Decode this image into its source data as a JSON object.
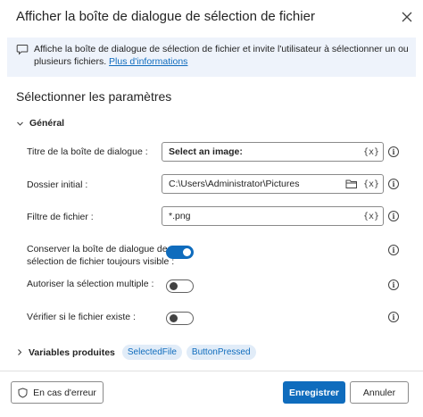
{
  "dialog": {
    "title": "Afficher la boîte de dialogue de sélection de fichier"
  },
  "info": {
    "text": "Affiche la boîte de dialogue de sélection de fichier et invite l'utilisateur à sélectionner un ou plusieurs fichiers.",
    "link": "Plus d'informations"
  },
  "section": {
    "title": "Sélectionner les paramètres",
    "group": "Général"
  },
  "fields": {
    "dialog_title": {
      "label": "Titre de la boîte de dialogue :",
      "value": "Select an image:",
      "var": "{x}"
    },
    "initial_folder": {
      "label": "Dossier initial :",
      "value": "C:\\Users\\Administrator\\Pictures",
      "var": "{x}"
    },
    "file_filter": {
      "label": "Filtre de fichier :",
      "value": "*.png",
      "var": "{x}"
    }
  },
  "toggles": {
    "keep_visible": {
      "label_line1": "Conserver la boîte de dialogue de",
      "label_line2": "sélection de fichier toujours visible :",
      "on": true
    },
    "multi_select": {
      "label": "Autoriser la sélection multiple :",
      "on": false
    },
    "check_exists": {
      "label": "Vérifier si le fichier existe :",
      "on": false
    }
  },
  "variables": {
    "label": "Variables produites",
    "items": [
      "SelectedFile",
      "ButtonPressed"
    ]
  },
  "footer": {
    "error_label": "En cas d'erreur",
    "save_label": "Enregistrer",
    "cancel_label": "Annuler"
  },
  "colors": {
    "accent": "#0f6cbd",
    "banner_bg": "#eef3fb",
    "chip_bg": "#e1ecf8"
  },
  "icons": {
    "close": "close-icon",
    "message": "message-icon",
    "chevron_down": "chevron-down-icon",
    "chevron_right": "chevron-right-icon",
    "folder": "folder-icon",
    "info": "info-icon",
    "shield": "shield-icon"
  }
}
